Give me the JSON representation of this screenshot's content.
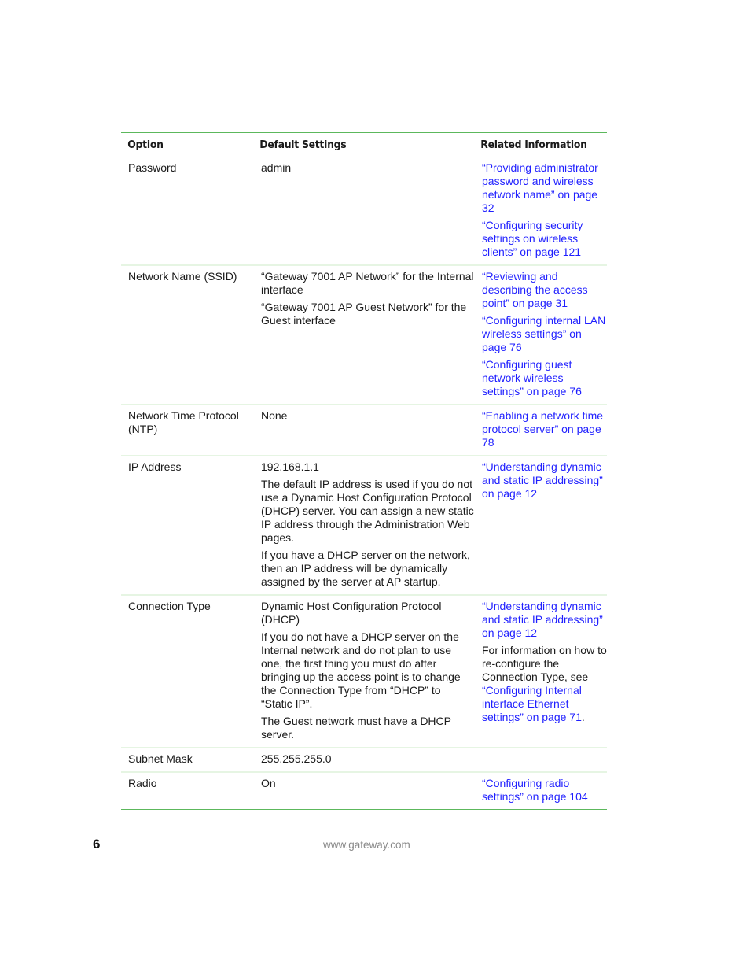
{
  "table": {
    "headers": [
      "Option",
      "Default Settings",
      "Related Information"
    ],
    "rows": [
      {
        "option": "Password",
        "defaults": [
          "admin"
        ],
        "related": [
          {
            "text": "“Providing administrator password and wireless network name” on page 32",
            "link": true
          },
          {
            "text": "“Configuring security settings on wireless clients” on page 121",
            "link": true
          }
        ]
      },
      {
        "option": "Network Name (SSID)",
        "defaults": [
          "“Gateway 7001 AP Network” for the Internal interface",
          "“Gateway 7001 AP Guest Network” for the Guest interface"
        ],
        "related": [
          {
            "text": "“Reviewing and describing the access point” on page 31",
            "link": true
          },
          {
            "text": "“Configuring internal LAN wireless settings” on page 76",
            "link": true
          },
          {
            "text": "“Configuring guest network wireless settings” on page 76",
            "link": true
          }
        ]
      },
      {
        "option": "Network Time Protocol (NTP)",
        "defaults": [
          "None"
        ],
        "related": [
          {
            "text": "“Enabling a network time protocol server” on page 78",
            "link": true
          }
        ]
      },
      {
        "option": "IP Address",
        "defaults": [
          "192.168.1.1",
          "The default IP address is used if you do not use a Dynamic Host Configuration Protocol (DHCP) server. You can assign a new static IP address through the Administration Web pages.",
          "If you have a DHCP server on the network, then an IP address will be dynamically assigned by the server at AP startup."
        ],
        "related": [
          {
            "text": "“Understanding dynamic and static IP addressing” on page 12",
            "link": true
          }
        ]
      },
      {
        "option": "Connection Type",
        "defaults": [
          "Dynamic Host Configuration Protocol (DHCP)",
          "If you do not have a DHCP server on the Internal network and do not plan to use one, the first thing you must do after bringing up the access point is to change the Connection Type from “DHCP” to “Static IP”.",
          "The Guest network must have a DHCP server."
        ],
        "related": [
          {
            "text": "“Understanding dynamic and static IP addressing” on page 12",
            "link": true
          },
          {
            "text": "For information on how to re-configure the Connection Type, see ",
            "link": false,
            "link_text": "“Configuring Internal interface Ethernet settings” on page 71",
            "suffix": "."
          }
        ]
      },
      {
        "option": "Subnet Mask",
        "defaults": [
          "255.255.255.0"
        ],
        "related": []
      },
      {
        "option": "Radio",
        "defaults": [
          "On"
        ],
        "related": [
          {
            "text": "“Configuring radio settings” on page 104",
            "link": true
          }
        ]
      }
    ]
  },
  "footer": {
    "page_number": "6",
    "url": "www.gateway.com"
  },
  "colors": {
    "link": "#1f1fff",
    "rule_strong": "#5cb85c",
    "rule_light": "#e6f5e3",
    "footer_url": "#8a8a8a"
  }
}
